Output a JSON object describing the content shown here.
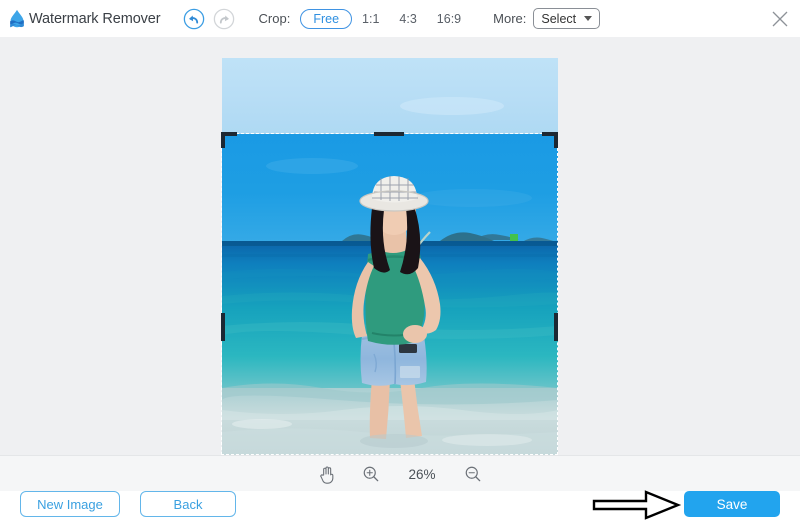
{
  "app": {
    "title": "Watermark Remover",
    "logo_icon": "water-drop-logo",
    "close_icon": "close-x-icon"
  },
  "toolbar": {
    "undo_icon": "undo-circle-arrow-icon",
    "redo_icon": "redo-circle-arrow-icon",
    "undo_enabled": true,
    "redo_enabled": false,
    "crop_label": "Crop:",
    "ratios": [
      {
        "label": "Free",
        "active": true
      },
      {
        "label": "1:1",
        "active": false
      },
      {
        "label": "4:3",
        "active": false
      },
      {
        "label": "16:9",
        "active": false
      }
    ],
    "more_label": "More:",
    "select_value": "Select",
    "select_caret_icon": "chevron-down-icon"
  },
  "canvas": {
    "image_alt": "woman-in-bucket-hat-standing-in-turquoise-sea",
    "crop_active": true
  },
  "zoombar": {
    "pan_icon": "hand-pan-icon",
    "zoom_in_icon": "zoom-in-magnifier-icon",
    "zoom_level": "26%",
    "zoom_out_icon": "zoom-out-magnifier-icon"
  },
  "footer": {
    "new_image_label": "New Image",
    "back_label": "Back",
    "save_label": "Save",
    "annotation_icon": "right-arrow-annotation"
  },
  "colors": {
    "accent_blue": "#22a4ee",
    "outline_blue": "#63b6ea",
    "canvas_bg": "#eff0f2",
    "zoombar_bg": "#f5f6f7"
  }
}
